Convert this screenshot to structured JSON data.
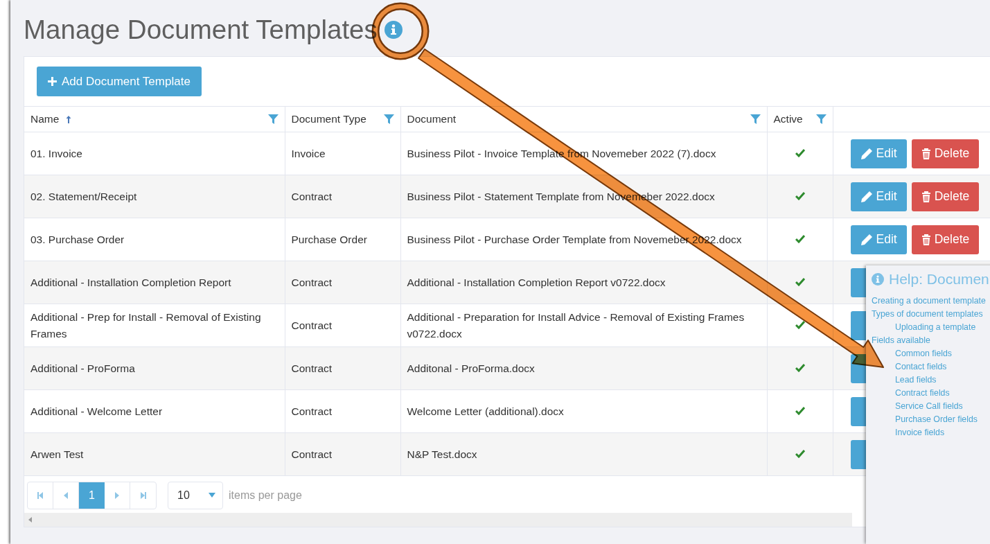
{
  "page": {
    "title": "Manage Document Templates",
    "add_button": "Add Document Template"
  },
  "table": {
    "columns": [
      {
        "label": "Name",
        "sorted": true,
        "filterable": true
      },
      {
        "label": "Document Type",
        "filterable": true
      },
      {
        "label": "Document",
        "filterable": true
      },
      {
        "label": "Active",
        "filterable": true
      }
    ],
    "rows": [
      {
        "name": "01. Invoice",
        "type": "Invoice",
        "document": "Business Pilot - Invoice Template from Novemeber 2022 (7).docx",
        "active": true,
        "actions": [
          "Edit",
          "Delete"
        ]
      },
      {
        "name": "02. Statement/Receipt",
        "type": "Contract",
        "document": "Business Pilot - Statement Template from Novemeber 2022.docx",
        "active": true,
        "actions": [
          "Edit",
          "Delete"
        ]
      },
      {
        "name": "03. Purchase Order",
        "type": "Purchase Order",
        "document": "Business Pilot - Purchase Order Template from Novemeber 2022.docx",
        "active": true,
        "actions": [
          "Edit",
          "Delete"
        ]
      },
      {
        "name": "Additional - Installation Completion Report",
        "type": "Contract",
        "document": "Additional - Installation Completion Report v0722.docx",
        "active": true,
        "edit_partly_hidden": true
      },
      {
        "name": "Additional - Prep for Install - Removal of Existing Frames",
        "type": "Contract",
        "document": "Additional - Preparation for Install Advice - Removal of Existing Frames v0722.docx",
        "active": true,
        "edit_partly_hidden": true
      },
      {
        "name": "Additional - ProForma",
        "type": "Contract",
        "document": "Additonal - ProForma.docx",
        "active": true,
        "edit_partly_hidden": true
      },
      {
        "name": "Additional - Welcome Letter",
        "type": "Contract",
        "document": "Welcome Letter (additional).docx",
        "active": true,
        "edit_partly_hidden": true
      },
      {
        "name": "Arwen Test",
        "type": "Contract",
        "document": "N&P Test.docx",
        "active": true,
        "edit_partly_hidden": true
      }
    ]
  },
  "pager": {
    "pages": [
      {
        "label": "1",
        "selected": true
      }
    ],
    "page_size": "10",
    "page_size_label": "items per page"
  },
  "help": {
    "title": "Help: Documen",
    "items": [
      {
        "label": "Creating a document template"
      },
      {
        "label": "Types of document templates",
        "children": [
          {
            "label": "Uploading a template"
          }
        ]
      },
      {
        "label": "Fields available",
        "children": [
          {
            "label": "Common fields"
          },
          {
            "label": "Contact fields"
          },
          {
            "label": "Lead fields"
          },
          {
            "label": "Contract fields"
          },
          {
            "label": "Service Call fields"
          },
          {
            "label": "Purchase Order fields"
          },
          {
            "label": "Invoice fields"
          }
        ]
      }
    ]
  },
  "callout": {
    "kind": "circle-arrow"
  }
}
